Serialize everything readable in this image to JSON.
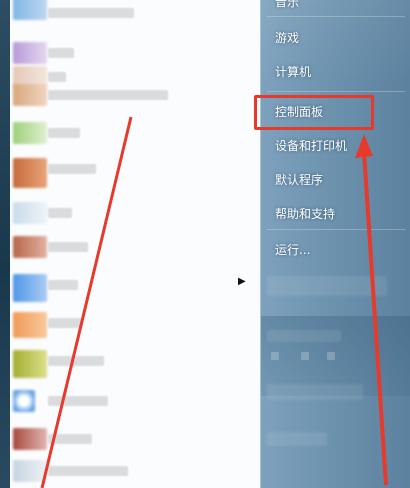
{
  "menu": {
    "places": [
      {
        "label": "音乐"
      },
      {
        "label": "游戏"
      },
      {
        "label": "计算机"
      },
      {
        "label": "控制面板"
      },
      {
        "label": "设备和打印机"
      },
      {
        "label": "默认程序"
      },
      {
        "label": "帮助和支持"
      },
      {
        "label": "运行..."
      }
    ]
  },
  "colors": {
    "annotation": "#e53a2c"
  },
  "icons": {
    "submenu": "right-triangle-icon"
  }
}
